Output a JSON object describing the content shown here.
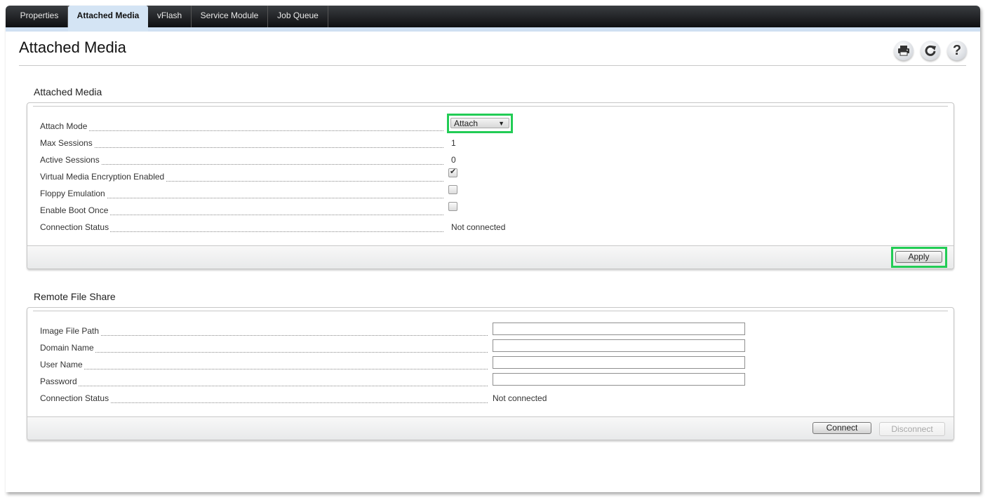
{
  "tabs": [
    {
      "label": "Properties",
      "active": false
    },
    {
      "label": "Attached Media",
      "active": true
    },
    {
      "label": "vFlash",
      "active": false
    },
    {
      "label": "Service Module",
      "active": false
    },
    {
      "label": "Job Queue",
      "active": false
    }
  ],
  "page": {
    "title": "Attached Media",
    "toolbar": {
      "print": "print-icon",
      "refresh": "refresh-icon",
      "help": "help-icon"
    }
  },
  "attached_media": {
    "section_title": "Attached Media",
    "attach_mode": {
      "label": "Attach Mode",
      "value": "Attach"
    },
    "max_sessions": {
      "label": "Max Sessions",
      "value": "1"
    },
    "active_sessions": {
      "label": "Active Sessions",
      "value": "0"
    },
    "encryption": {
      "label": "Virtual Media Encryption Enabled",
      "checked": true
    },
    "floppy": {
      "label": "Floppy Emulation",
      "checked": false
    },
    "boot_once": {
      "label": "Enable Boot Once",
      "checked": false
    },
    "connection_status": {
      "label": "Connection Status",
      "value": "Not connected"
    },
    "apply_label": "Apply"
  },
  "remote_file_share": {
    "section_title": "Remote File Share",
    "image_file_path": {
      "label": "Image File Path",
      "value": ""
    },
    "domain_name": {
      "label": "Domain Name",
      "value": ""
    },
    "user_name": {
      "label": "User Name",
      "value": ""
    },
    "password": {
      "label": "Password",
      "value": ""
    },
    "connection_status": {
      "label": "Connection Status",
      "value": "Not connected"
    },
    "connect_label": "Connect",
    "disconnect_label": "Disconnect"
  },
  "colors": {
    "highlight": "#22cc55",
    "tab_active_bg": "#d4e4f4",
    "tabbar_bg": "#1a1b1d"
  }
}
